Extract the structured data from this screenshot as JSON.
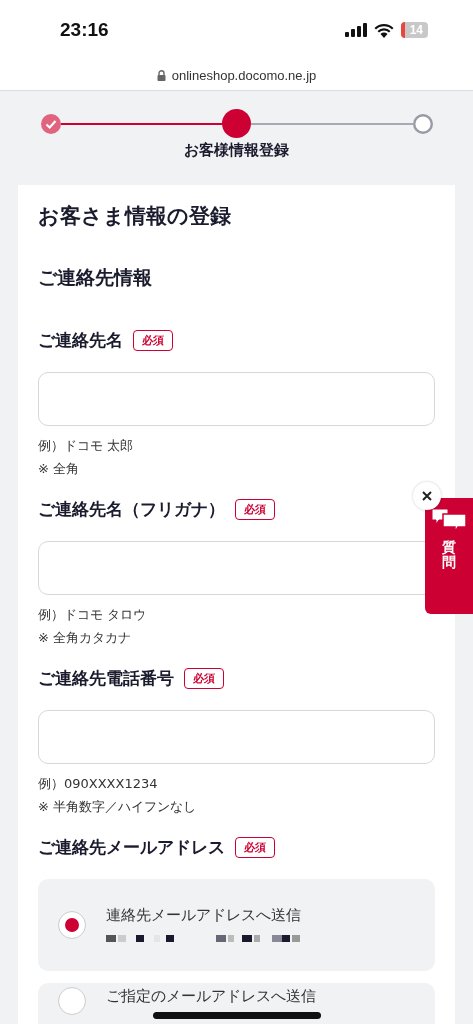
{
  "status_bar": {
    "time": "23:16",
    "battery": "14"
  },
  "address_bar": {
    "url": "onlineshop.docomo.ne.jp"
  },
  "stepper": {
    "steps": [
      {
        "kind": "done"
      },
      {
        "kind": "current"
      },
      {
        "kind": "todo"
      }
    ],
    "label": "お客様情報登録"
  },
  "page_title": "お客さま情報の登録",
  "section_title": "ご連絡先情報",
  "fields": [
    {
      "label": "ご連絡先名",
      "badge": "必須",
      "hints": [
        "例）ドコモ 太郎",
        "※ 全角"
      ]
    },
    {
      "label": "ご連絡先名（フリガナ）",
      "badge": "必須",
      "hints": [
        "例）ドコモ タロウ",
        "※ 全角カタカナ"
      ]
    },
    {
      "label": "ご連絡先電話番号",
      "badge": "必須",
      "hints": [
        "例）090XXXX1234",
        "※ 半角数字／ハイフンなし"
      ]
    }
  ],
  "email": {
    "label": "ご連絡先メールアドレス",
    "badge": "必須",
    "options": [
      {
        "kind": "masked_email",
        "label": "連絡先メールアドレスへ送信",
        "selected": true
      },
      {
        "kind": "plain",
        "label": "ご指定のメールアドレスへ送信",
        "selected": false
      }
    ]
  },
  "help_tab": {
    "label": "質問"
  }
}
